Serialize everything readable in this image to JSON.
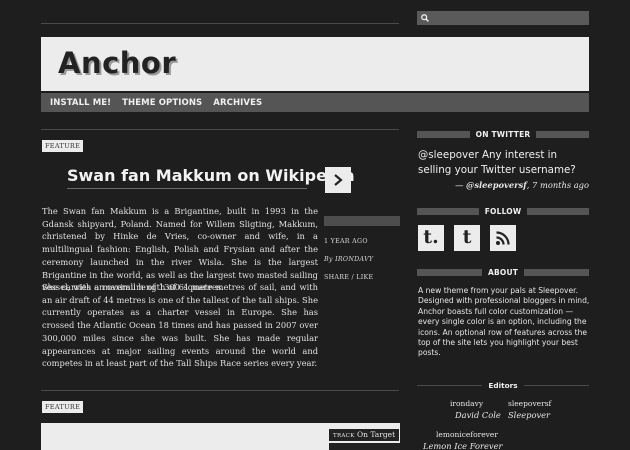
{
  "site": {
    "title": "Anchor"
  },
  "search": {
    "placeholder": ""
  },
  "nav": {
    "items": [
      "INSTALL ME!",
      "THEME OPTIONS",
      "ARCHIVES"
    ]
  },
  "posts": [
    {
      "tag": "FEATURE",
      "title": "Swan fan Makkum on Wikipedia",
      "paragraphs": [
        "The Swan fan Makkum is a Brigantine, built in 1993 in the Gdansk shipyard, Poland. Named for Willem Sligting, Makkum, christened by Hinke de Vries, co-owner and wife, in a multilingual fashion: English, Polish and Frysian and after the ceremony launched in the river Wisla. She is the largest Brigantine in the world, as well as the largest two masted sailing vessel, with an overall length of 61 metres.",
        "She carries a maximum of 1300 square metres of sail, and with an air draft of 44 metres is one of the tallest of the tall ships. She currently operates as a charter vessel in Europe. She has crossed the Atlantic Ocean 18 times and has passed in 2007 over 300,000 miles since she was built. She has made regular appearances at major sailing events around the world and competes in at least part of the Tall Ships Race series every year."
      ],
      "meta": {
        "time": "1 YEAR AGO",
        "author": "By IRONDAVY",
        "actions": "SHARE / LIKE"
      }
    },
    {
      "tag": "FEATURE",
      "track_prefix": "TRACK",
      "track_title": "On Target"
    }
  ],
  "sidebar": {
    "twitter": {
      "heading": "ON TWITTER",
      "tweet": "@sleepover Any interest in selling your Twitter username?",
      "dash": "— ",
      "handle": "@sleepoversf",
      "time": ", 7 months ago"
    },
    "follow": {
      "heading": "FOLLOW",
      "icons": [
        "tumblr-icon",
        "tumblr-icon",
        "rss-icon"
      ],
      "glyph": "t."
    },
    "about": {
      "heading": "ABOUT",
      "text": "A new theme from your pals at Sleepover. Designed with professional bloggers in mind, Anchor boasts full color customization — every single color is an option, including the icons. An optional row of features across the top of the site lets you highlight your best posts."
    },
    "editors": {
      "heading": "Editors",
      "list": [
        {
          "user": "irondavy",
          "name": "David Cole"
        },
        {
          "user": "sleepoversf",
          "name": "Sleepover"
        },
        {
          "user": "lemoniceforever",
          "name": "Lemon Ice Forever"
        }
      ]
    }
  },
  "colors": {
    "background": "#1e1e1e",
    "panel": "#ececec",
    "nav": "#555555"
  }
}
